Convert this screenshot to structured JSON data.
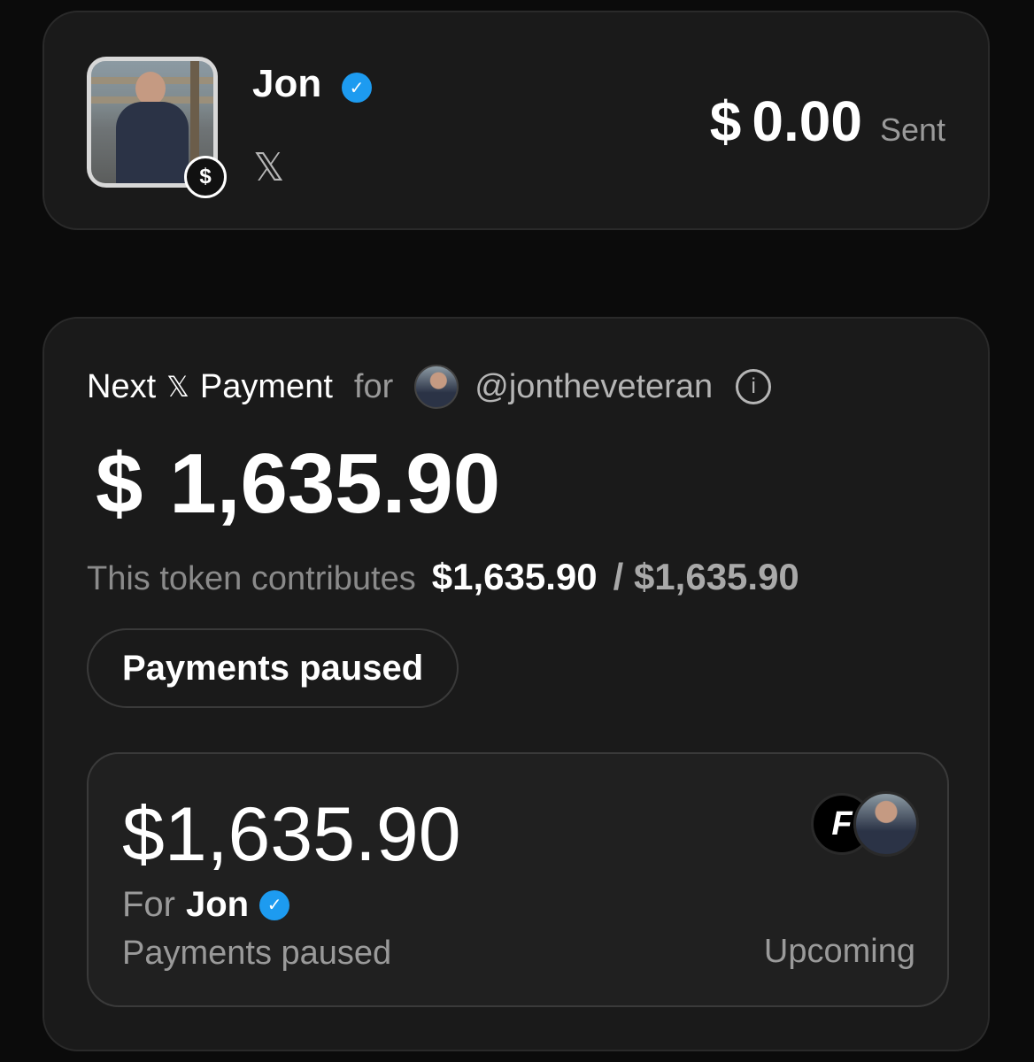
{
  "profile": {
    "name": "Jon",
    "avatar_badge_symbol": "$",
    "platform_icon": "x-logo-icon",
    "platform_glyph": "𝕏",
    "sent_currency_symbol": "$",
    "sent_amount": "0.00",
    "sent_label": "Sent",
    "verified_glyph": "✓"
  },
  "payment": {
    "title_prefix": "Next",
    "title_x": "𝕏",
    "title_suffix": "Payment",
    "for_label": "for",
    "handle": "@jontheveteran",
    "info_glyph": "i",
    "currency_symbol": "$",
    "amount": "1,635.90",
    "contrib_label": "This token contributes",
    "contrib_value": "$1,635.90",
    "contrib_total": "/ $1,635.90",
    "status_pill": "Payments paused"
  },
  "upcoming_card": {
    "amount": "$1,635.90",
    "for_word": "For",
    "recipient": "Jon",
    "status": "Payments paused",
    "schedule": "Upcoming",
    "token_glyph": "F"
  },
  "colors": {
    "background": "#0b0b0b",
    "card": "#1a1a1a",
    "verified_blue": "#1d9bf0",
    "muted_text": "#9a9a9a"
  }
}
